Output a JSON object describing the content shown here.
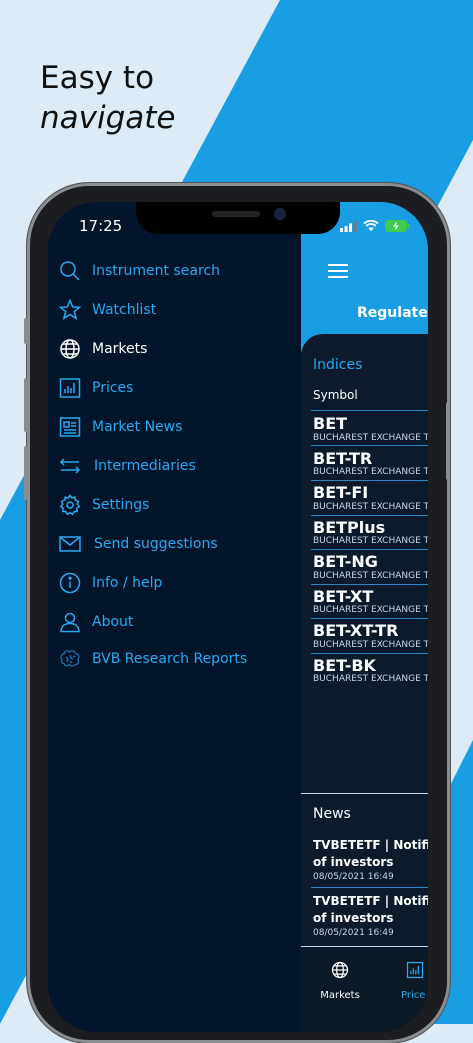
{
  "headline": {
    "line1": "Easy to",
    "line2": "navigate"
  },
  "status_bar": {
    "time": "17:25"
  },
  "app": {
    "selected_tab": "Regulated",
    "indices": {
      "section_title": "Indices",
      "column_header": "Symbol",
      "rows": [
        {
          "symbol": "BET",
          "exchange": "BUCHAREST EXCHANGE T"
        },
        {
          "symbol": "BET-TR",
          "exchange": "BUCHAREST EXCHANGE T"
        },
        {
          "symbol": "BET-FI",
          "exchange": "BUCHAREST EXCHANGE T"
        },
        {
          "symbol": "BETPlus",
          "exchange": "BUCHAREST EXCHANGE T"
        },
        {
          "symbol": "BET-NG",
          "exchange": "BUCHAREST EXCHANGE T"
        },
        {
          "symbol": "BET-XT",
          "exchange": "BUCHAREST EXCHANGE T"
        },
        {
          "symbol": "BET-XT-TR",
          "exchange": "BUCHAREST EXCHANGE T"
        },
        {
          "symbol": "BET-BK",
          "exchange": "BUCHAREST EXCHANGE T"
        }
      ]
    },
    "news": {
      "section_title": "News",
      "items": [
        {
          "line1": "TVBETETF | Notific",
          "line2": "of investors",
          "date": "08/05/2021 16:49"
        },
        {
          "line1": "TVBETETF | Notific",
          "line2": "of investors",
          "date": "08/05/2021 16:49"
        }
      ]
    },
    "bottom_nav": [
      {
        "label": "Markets",
        "icon": "globe-icon"
      },
      {
        "label": "Price",
        "icon": "bar-chart-icon"
      }
    ]
  },
  "drawer": {
    "items": [
      {
        "label": "Instrument search",
        "icon": "search-icon",
        "active": false
      },
      {
        "label": "Watchlist",
        "icon": "star-icon",
        "active": false
      },
      {
        "label": "Markets",
        "icon": "globe-icon",
        "active": true
      },
      {
        "label": "Prices",
        "icon": "bar-chart-icon",
        "active": false
      },
      {
        "label": "Market News",
        "icon": "newspaper-icon",
        "active": false
      },
      {
        "label": "Intermediaries",
        "icon": "arrows-icon",
        "active": false
      },
      {
        "label": "Settings",
        "icon": "gear-icon",
        "active": false
      },
      {
        "label": "Send suggestions",
        "icon": "envelope-icon",
        "active": false
      },
      {
        "label": "Info / help",
        "icon": "info-icon",
        "active": false
      },
      {
        "label": "About",
        "icon": "user-icon",
        "active": false
      },
      {
        "label": "BVB Research Reports",
        "icon": "brain-icon",
        "active": false
      }
    ]
  },
  "colors": {
    "accent": "#29a9f0",
    "header": "#1a9ee3",
    "drawer_bg": "#03152a",
    "page_bg": "#dcebf5"
  }
}
